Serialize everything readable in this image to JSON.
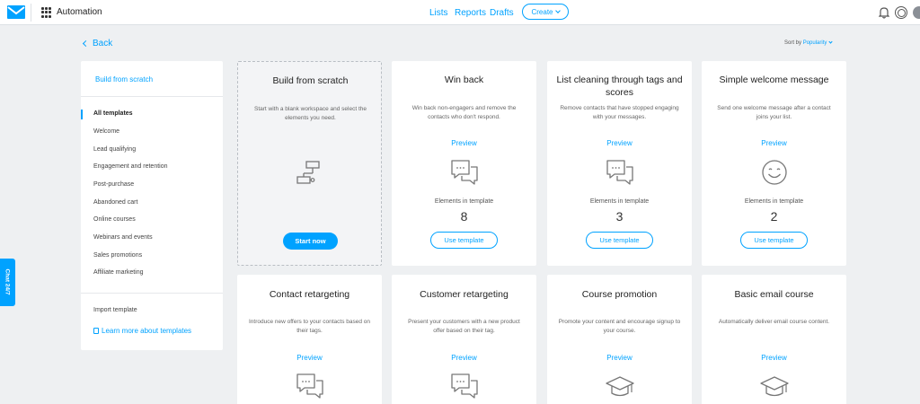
{
  "header": {
    "app_title": "Automation",
    "nav": {
      "lists": "Lists",
      "reports": "Reports",
      "drafts": "Drafts"
    },
    "create_label": "Create",
    "icons": [
      "envelope-logo-icon",
      "apps-grid-icon",
      "bell-icon",
      "help-icon",
      "avatar"
    ]
  },
  "toolbar": {
    "back_label": "Back",
    "sort_label": "Sort by",
    "sort_value": "Popularity"
  },
  "sidebar": {
    "build_label": "Build from scratch",
    "categories": [
      "All templates",
      "Welcome",
      "Lead qualifying",
      "Engagement and retention",
      "Post-purchase",
      "Abandoned cart",
      "Online courses",
      "Webinars and events",
      "Sales promotions",
      "Affiliate marketing"
    ],
    "import_label": "Import template",
    "learn_label": "Learn more about templates"
  },
  "scratch_card": {
    "title": "Build from scratch",
    "description": "Start with a blank workspace and select the elements you need.",
    "button": "Start now"
  },
  "labels": {
    "preview": "Preview",
    "elements": "Elements in template",
    "use": "Use template"
  },
  "templates": [
    {
      "title": "Win back",
      "description": "Win back non-engagers and remove the contacts who don't respond.",
      "elements": "8",
      "icon": "chat-bubbles-icon"
    },
    {
      "title": "List cleaning through tags and scores",
      "description": "Remove contacts that have stopped engaging with your messages.",
      "elements": "3",
      "icon": "chat-bubbles-icon"
    },
    {
      "title": "Simple welcome message",
      "description": "Send one welcome message after a contact joins your list.",
      "elements": "2",
      "icon": "smiley-icon"
    },
    {
      "title": "Contact retargeting",
      "description": "Introduce new offers to your contacts based on their tags.",
      "icon": "chat-bubbles-icon"
    },
    {
      "title": "Customer retargeting",
      "description": "Present your customers with a new product offer based on their tag.",
      "icon": "chat-bubbles-icon"
    },
    {
      "title": "Course promotion",
      "description": "Promote your content and encourage signup to your course.",
      "icon": "graduation-cap-icon"
    },
    {
      "title": "Basic email course",
      "description": "Automatically deliver email course content.",
      "icon": "graduation-cap-icon"
    }
  ],
  "chat_widget": {
    "label": "Chat 24/7"
  },
  "colors": {
    "accent": "#00a2ff",
    "background": "#eef0f2",
    "card": "#ffffff"
  }
}
